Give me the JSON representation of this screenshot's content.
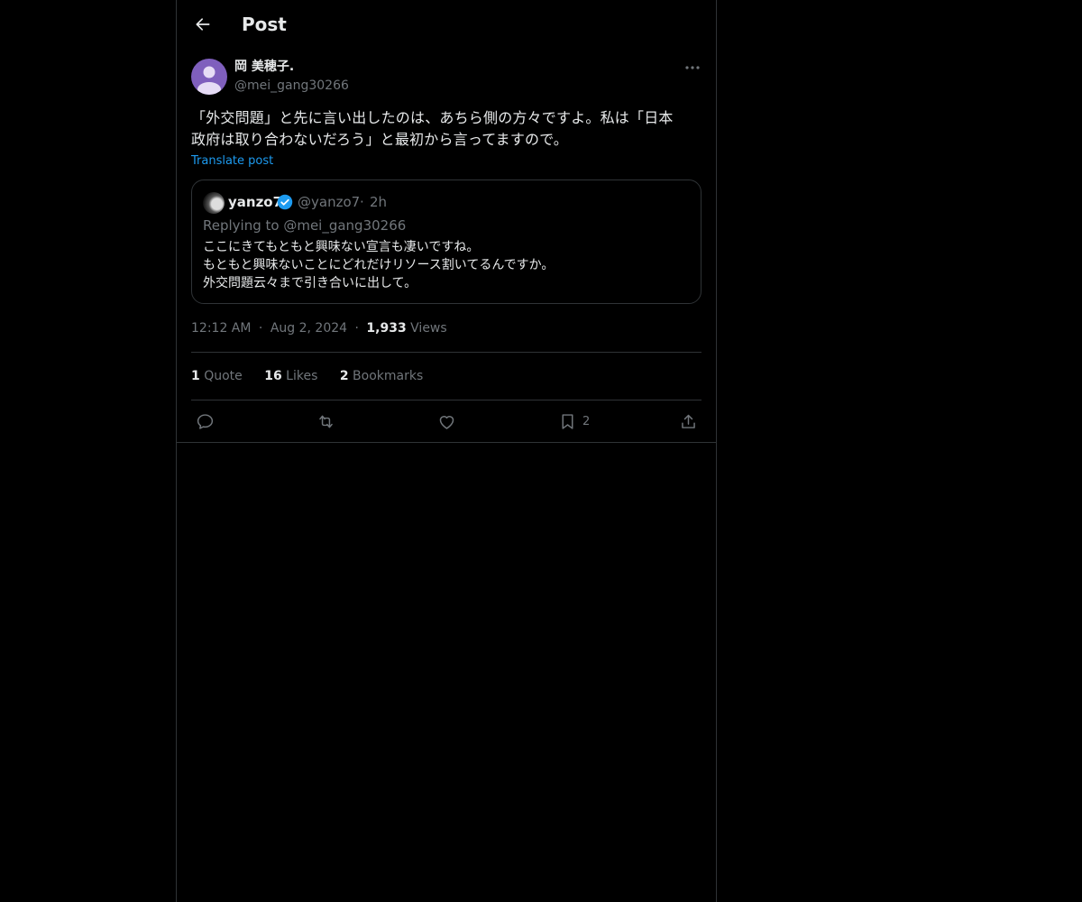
{
  "header": {
    "title": "Post"
  },
  "post": {
    "author_name": "岡 美穂子.",
    "author_handle": "@mei_gang30266",
    "text_line1": "「外交問題」と先に言い出したのは、あちら側の方々ですよ。私は「日本",
    "text_line2": "政府は取り合わないだろう」と最初から言ってますので。",
    "translate_label": "Translate post"
  },
  "quote": {
    "name": "yanzo7",
    "handle": "@yanzo7",
    "separator": "·",
    "time": "2h",
    "replying_to": "Replying to @mei_gang30266",
    "lines": [
      "ここにきてもともと興味ない宣言も凄いですね。",
      "もともと興味ないことにどれだけリソース割いてるんですか。",
      "外交問題云々まで引き合いに出して。"
    ]
  },
  "meta": {
    "time": "12:12 AM",
    "separator": "·",
    "date": "Aug 2, 2024",
    "views_count": "1,933",
    "views_label": "Views"
  },
  "stats": {
    "quote_count": "1",
    "quote_label": "Quote",
    "likes_count": "16",
    "likes_label": "Likes",
    "bookmarks_count": "2",
    "bookmarks_label": "Bookmarks"
  },
  "actions": {
    "bookmark_count": "2",
    "icons": [
      "reply-icon",
      "repost-icon",
      "like-icon",
      "bookmark-icon",
      "share-icon"
    ]
  },
  "colors": {
    "background": "#000000",
    "text": "#e7e9ea",
    "muted": "#71767b",
    "accent": "#1d9bf0",
    "border": "#2f3336",
    "avatar": "#7f5fbd"
  }
}
